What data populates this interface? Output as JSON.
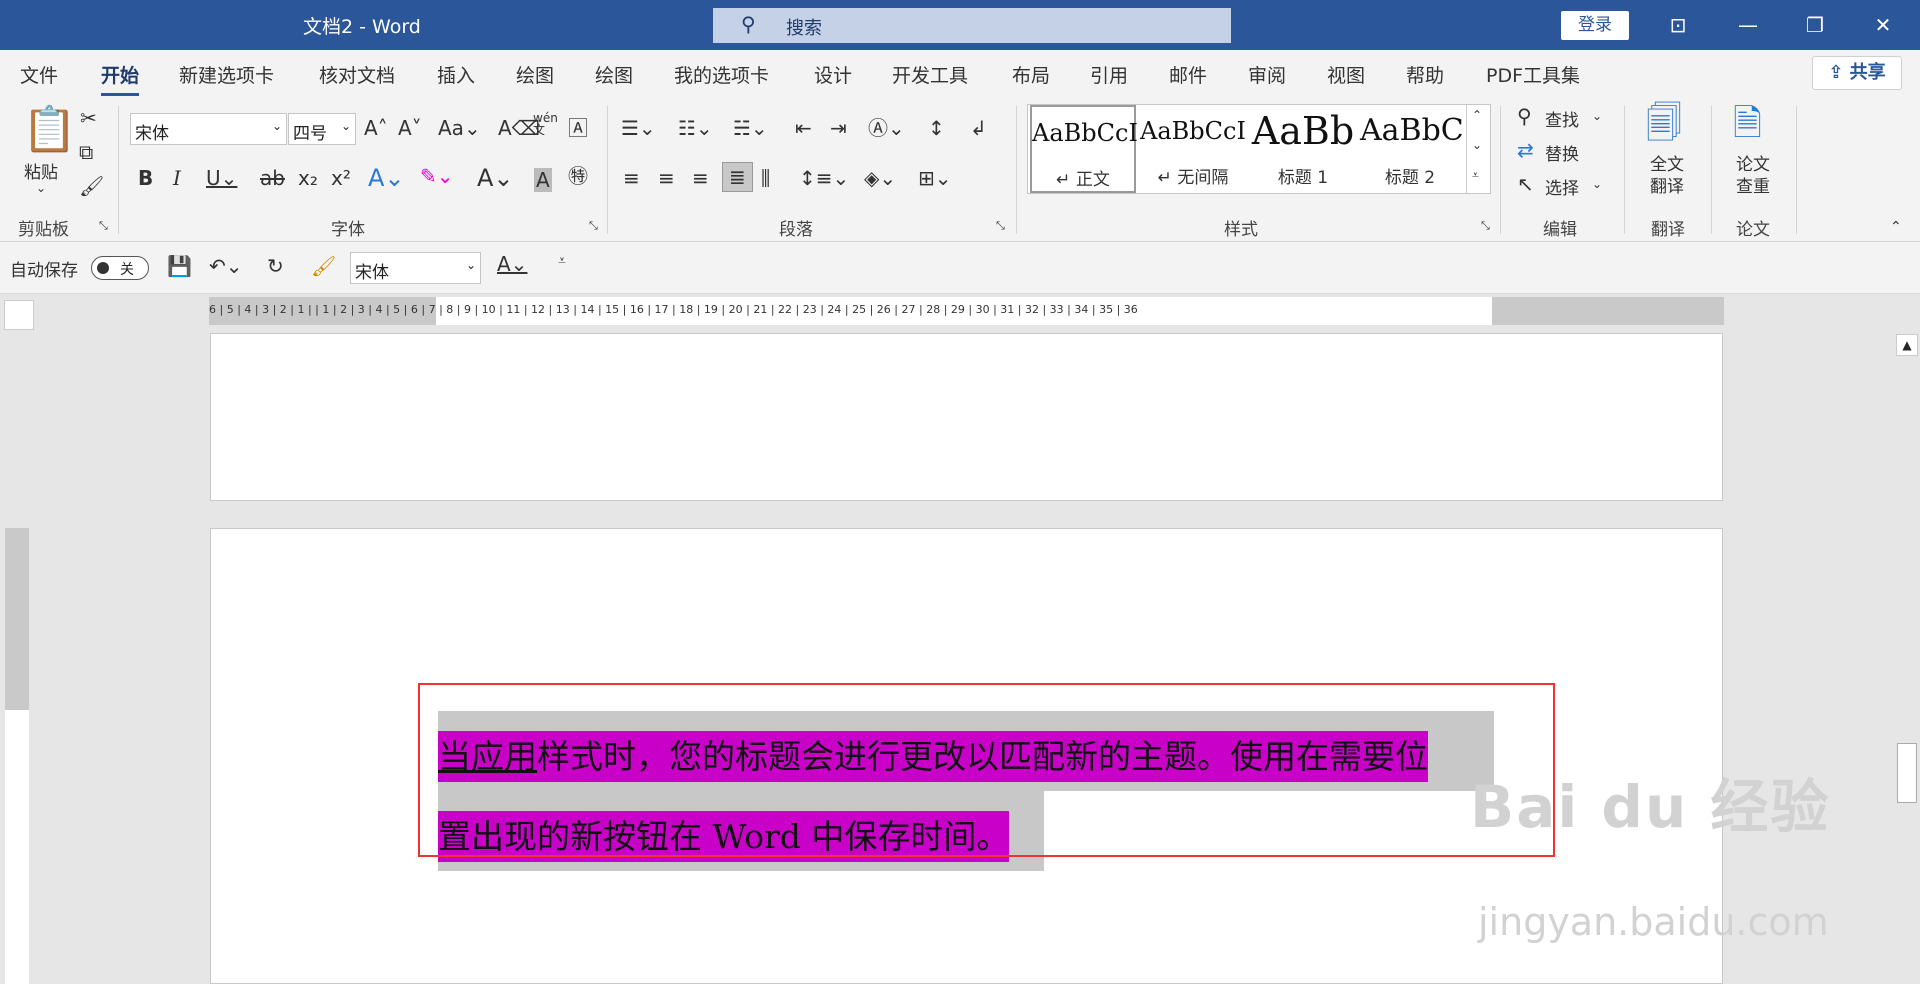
{
  "titlebar": {
    "doc_title": "文档2 - Word",
    "search_placeholder": "搜索",
    "login": "登录"
  },
  "tabs": [
    "文件",
    "开始",
    "新建选项卡",
    "核对文档",
    "插入",
    "绘图",
    "绘图",
    "我的选项卡",
    "设计",
    "开发工具",
    "布局",
    "引用",
    "邮件",
    "审阅",
    "视图",
    "帮助",
    "PDF工具集"
  ],
  "share_label": "共享",
  "ribbon": {
    "clipboard": {
      "paste": "粘贴",
      "label": "剪贴板"
    },
    "font": {
      "name": "宋体",
      "size": "四号",
      "label": "字体",
      "pinyin": "wén",
      "pinyin_char": "文"
    },
    "paragraph": {
      "label": "段落"
    },
    "styles": {
      "label": "样式",
      "items": [
        {
          "sample": "AaBbCcI",
          "name": "↵ 正文"
        },
        {
          "sample": "AaBbCcI",
          "name": "↵ 无间隔"
        },
        {
          "sample": "AaBb",
          "name": "标题 1"
        },
        {
          "sample": "AaBbC",
          "name": "标题 2"
        }
      ]
    },
    "editing": {
      "find": "查找",
      "replace": "替换",
      "select": "选择",
      "label": "编辑"
    },
    "translate": {
      "btn_line1": "全文",
      "btn_line2": "翻译",
      "label": "翻译"
    },
    "thesis": {
      "btn_line1": "论文",
      "btn_line2": "查重",
      "label": "论文"
    }
  },
  "qat": {
    "autosave": "自动保存",
    "toggle_state": "关",
    "font": "宋体"
  },
  "ruler": {
    "h_numbers": "6 | 5 | 4 | 3 | 2 | 1 |  | 1 | 2 | 3 | 4 | 5 | 6 | 7 | 8 | 9 | 10 | 11 | 12 | 13 | 14 | 15 | 16 | 17 | 18 | 19 | 20 | 21 | 22 | 23 | 24 | 25 | 26 | 27 | 28 | 29 | 30 | 31 | 32 | 33 | 34 | 35 | 36"
  },
  "document": {
    "line1_underlined": "当应用",
    "line1_rest": "样式时，您的标题会进行更改以匹配新的主题。使用在需要位",
    "line2": "置出现的新按钮在 Word 中保存时间。"
  },
  "watermark": {
    "logo": "Bai du 经验",
    "url": "jingyan.baidu.com"
  }
}
